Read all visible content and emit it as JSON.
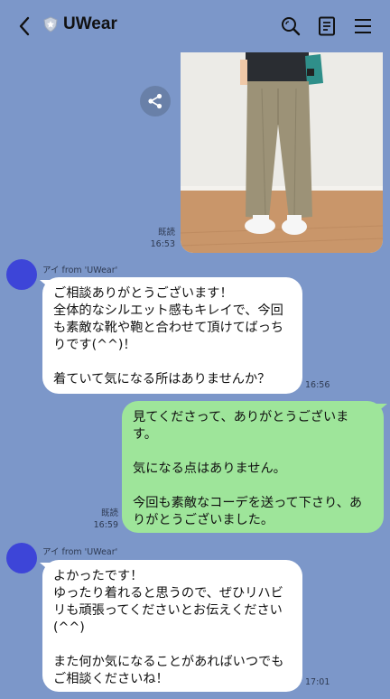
{
  "header": {
    "back_icon": "chevron-left-icon",
    "badge_icon": "shield-badge-icon",
    "title": "UWear",
    "search_icon": "search-icon",
    "notes_icon": "notes-icon",
    "menu_icon": "hamburger-menu-icon"
  },
  "colors": {
    "background": "#7c97c9",
    "bubble_sent": "#9ee59a",
    "bubble_received": "#ffffff",
    "avatar": "#3d45d8"
  },
  "messages": [
    {
      "type": "image",
      "direction": "sent",
      "read_label": "既読",
      "time": "16:53"
    },
    {
      "direction": "received",
      "sender": "アイ from 'UWear'",
      "text": "ご相談ありがとうございます！\n全体的なシルエット感もキレイで、今回も素敵な靴や鞄と合わせて頂けてばっちりです(^^)！\n\n着ていて気になる所はありませんか？",
      "time": "16:56"
    },
    {
      "direction": "sent",
      "text": "見てくださって、ありがとうございます。\n\n気になる点はありません。\n\n今回も素敵なコーデを送って下さり、ありがとうございました。",
      "read_label": "既読",
      "time": "16:59"
    },
    {
      "direction": "received",
      "sender": "アイ from 'UWear'",
      "text": "よかったです！\nゆったり着れると思うので、ぜひリハビリも頑張ってくださいとお伝えください(^^)\n\nまた何か気になることがあればいつでもご相談くださいね！",
      "time": "17:01"
    }
  ]
}
